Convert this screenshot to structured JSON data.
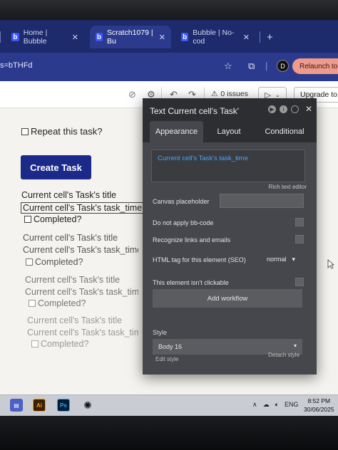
{
  "browser": {
    "tabs": [
      {
        "label": "Home | Bubble",
        "active": false
      },
      {
        "label": "Scratch1079 | Bu",
        "active": true
      },
      {
        "label": "Bubble | No-cod",
        "active": false
      }
    ],
    "url": "s=bTHFd",
    "profile_initial": "D",
    "relaunch_label": "Relaunch to u"
  },
  "toolbar": {
    "issues_label": "0 issues",
    "upgrade_label": "Upgrade to"
  },
  "canvas": {
    "repeat_label": "Repeat this task?",
    "create_task_label": "Create Task",
    "rows": [
      {
        "title": "Current cell's Task's title",
        "time": "Current cell's Task's task_time",
        "done": "Completed?"
      },
      {
        "title": "Current cell's Task's title",
        "time": "Current cell's Task's task_time",
        "done": "Completed?"
      },
      {
        "title": "Current cell's Task's title",
        "time": "Current cell's Task's task_time",
        "done": "Completed?"
      },
      {
        "title": "Current cell's Task's title",
        "time": "Current cell's Task's task_time",
        "done": "Completed?"
      }
    ]
  },
  "panel": {
    "title": "Text Current cell's Task'",
    "tabs": [
      "Appearance",
      "Layout",
      "Conditional"
    ],
    "text_content": "Current cell's Task's task_time",
    "rich_text_label": "Rich text editor",
    "canvas_placeholder_label": "Canvas placeholder",
    "bbcode_label": "Do not apply bb-code",
    "links_label": "Recognize links and emails",
    "seo_label": "HTML tag for this element (SEO)",
    "seo_value": "normal",
    "not_clickable_label": "This element isn't clickable",
    "add_workflow_label": "Add workflow",
    "style_label": "Style",
    "style_value": "Body 16",
    "edit_style_label": "Edit style",
    "detach_style_label": "Detach style"
  },
  "taskbar": {
    "lang": "ENG",
    "time": "8:52 PM",
    "date": "30/06/2025",
    "apps": [
      "Ai",
      "Ps"
    ]
  },
  "colors": {
    "accent": "#1b2a88",
    "bubble_blue": "#3b55ff",
    "relaunch": "#f09a8c",
    "panel_bg": "#45474c",
    "dynamic_text": "#4aa3ff"
  }
}
